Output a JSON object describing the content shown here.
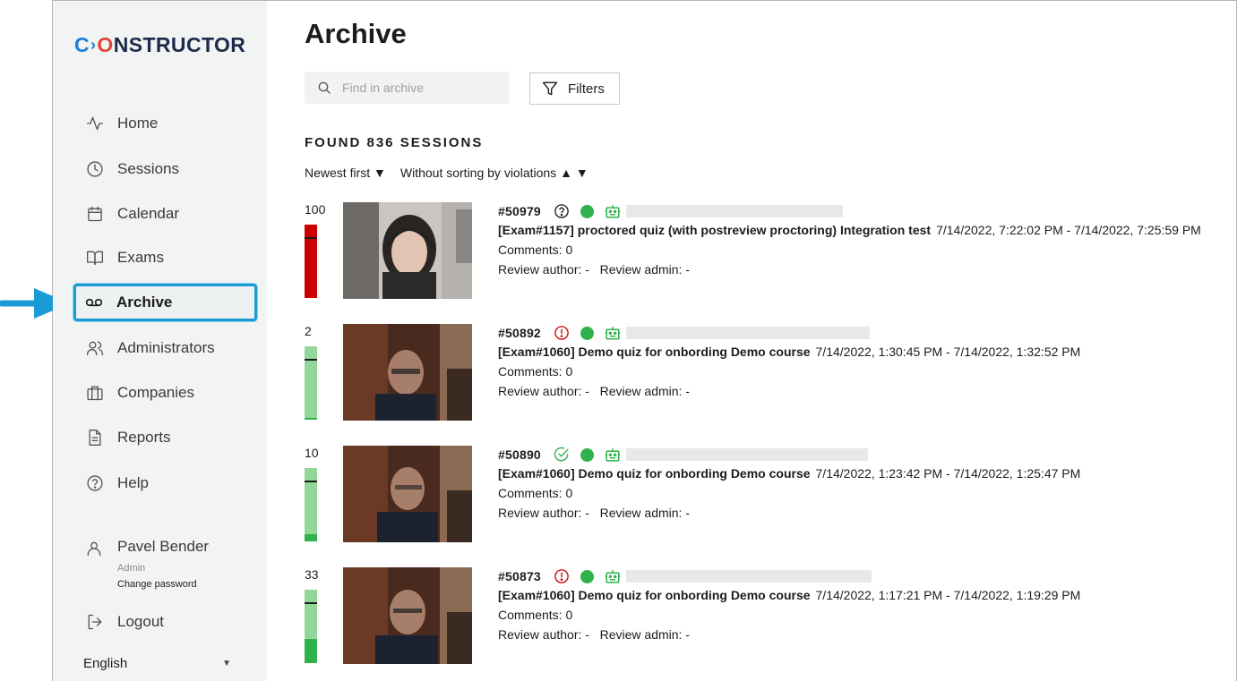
{
  "brand": {
    "logo_c": "C",
    "logo_arrow": "›",
    "logo_o": "O",
    "logo_rest": "NSTRUCTOR"
  },
  "sidebar": {
    "items": [
      {
        "label": "Home",
        "icon": "activity-icon"
      },
      {
        "label": "Sessions",
        "icon": "clock-icon"
      },
      {
        "label": "Calendar",
        "icon": "calendar-icon"
      },
      {
        "label": "Exams",
        "icon": "book-icon"
      },
      {
        "label": "Archive",
        "icon": "voicemail-icon",
        "active": true
      },
      {
        "label": "Administrators",
        "icon": "users-icon"
      },
      {
        "label": "Companies",
        "icon": "briefcase-icon"
      },
      {
        "label": "Reports",
        "icon": "file-text-icon"
      },
      {
        "label": "Help",
        "icon": "help-circle-icon"
      }
    ],
    "user": {
      "name": "Pavel Bender",
      "role": "Admin",
      "change_password": "Change password"
    },
    "logout": "Logout",
    "language": "English"
  },
  "main": {
    "title": "Archive",
    "search_placeholder": "Find in archive",
    "filters_label": "Filters",
    "found": "FOUND 836 SESSIONS",
    "sort_newest": "Newest first ▼",
    "sort_violations": "Without sorting by violations ▲ ▼"
  },
  "sessions": [
    {
      "score": "100",
      "id": "#50979",
      "status": "question",
      "exam": "[Exam#1157] proctored quiz (with postreview proctoring) Integration test",
      "time": "7/14/2022, 7:22:02 PM - 7/14/2022, 7:25:59 PM",
      "comments": "Comments: 0",
      "review_author": "Review author: -",
      "review_admin": "Review admin: -",
      "level": 1.0,
      "level_color": "#cc0000"
    },
    {
      "score": "2",
      "id": "#50892",
      "status": "alert",
      "exam": "[Exam#1060] Demo quiz for onbording Demo course",
      "time": "7/14/2022, 1:30:45 PM - 7/14/2022, 1:32:52 PM",
      "comments": "Comments: 0",
      "review_author": "Review author: -",
      "review_admin": "Review admin: -",
      "level": 0.02,
      "level_color": "#2fb24b"
    },
    {
      "score": "10",
      "id": "#50890",
      "status": "check",
      "exam": "[Exam#1060] Demo quiz for onbording Demo course",
      "time": "7/14/2022, 1:23:42 PM - 7/14/2022, 1:25:47 PM",
      "comments": "Comments: 0",
      "review_author": "Review author: -",
      "review_admin": "Review admin: -",
      "level": 0.1,
      "level_color": "#2fb24b"
    },
    {
      "score": "33",
      "id": "#50873",
      "status": "alert",
      "exam": "[Exam#1060] Demo quiz for onbording Demo course",
      "time": "7/14/2022, 1:17:21 PM - 7/14/2022, 1:19:29 PM",
      "comments": "Comments: 0",
      "review_author": "Review author: -",
      "review_admin": "Review admin: -",
      "level": 0.33,
      "level_color": "#2fb24b"
    }
  ],
  "colors": {
    "accent": "#1a9bd6",
    "online": "#2fb24b",
    "danger": "#cc0000"
  }
}
